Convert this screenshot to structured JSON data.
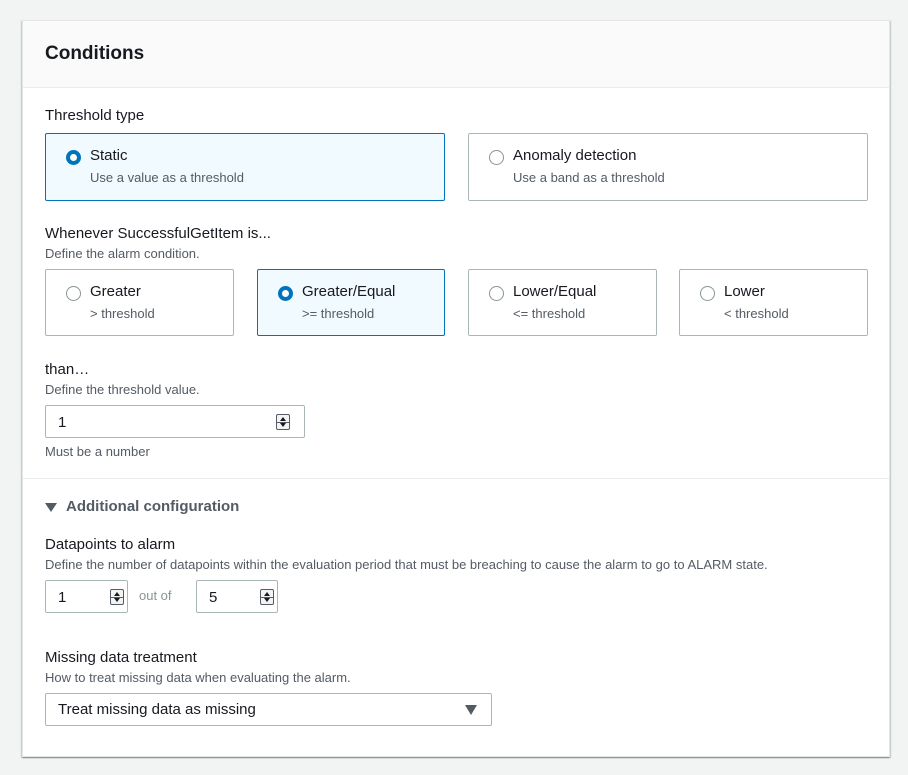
{
  "panel": {
    "title": "Conditions"
  },
  "threshold_type": {
    "label": "Threshold type",
    "options": [
      {
        "title": "Static",
        "desc": "Use a value as a threshold",
        "selected": true
      },
      {
        "title": "Anomaly detection",
        "desc": "Use a band as a threshold",
        "selected": false
      }
    ]
  },
  "condition": {
    "label": "Whenever SuccessfulGetItem is...",
    "desc": "Define the alarm condition.",
    "options": [
      {
        "title": "Greater",
        "desc": "> threshold",
        "selected": false
      },
      {
        "title": "Greater/Equal",
        "desc": ">= threshold",
        "selected": true
      },
      {
        "title": "Lower/Equal",
        "desc": "<= threshold",
        "selected": false
      },
      {
        "title": "Lower",
        "desc": "< threshold",
        "selected": false
      }
    ]
  },
  "threshold": {
    "label": "than…",
    "desc": "Define the threshold value.",
    "value": "1",
    "hint": "Must be a number"
  },
  "additional": {
    "label": "Additional configuration",
    "datapoints": {
      "label": "Datapoints to alarm",
      "desc": "Define the number of datapoints within the evaluation period that must be breaching to cause the alarm to go to ALARM state.",
      "value": "1",
      "out_of_label": "out of",
      "period": "5"
    },
    "missing": {
      "label": "Missing data treatment",
      "desc": "How to treat missing data when evaluating the alarm.",
      "selected": "Treat missing data as missing"
    }
  },
  "colors": {
    "accent": "#0073bb",
    "selected_bg": "#f1faff",
    "border": "#aab7b8"
  }
}
